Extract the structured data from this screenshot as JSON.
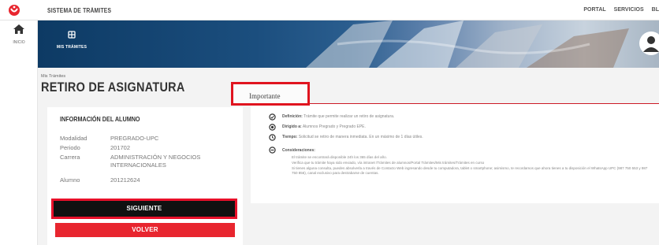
{
  "header": {
    "system_title": "SISTEMA DE TRÁMITES",
    "links": [
      "PORTAL",
      "SERVICIOS",
      "BL"
    ]
  },
  "nav": {
    "home_label": "INICIO"
  },
  "banner": {
    "module_label": "MIS TRÁMITES"
  },
  "breadcrumb": "Mis Trámites",
  "page_title": "RETIRO DE ASIGNATURA",
  "student_info": {
    "heading": "INFORMACIÓN DEL ALUMNO",
    "rows": [
      {
        "label": "Modalidad",
        "value": "PREGRADO-UPC"
      },
      {
        "label": "Periodo",
        "value": "201702"
      },
      {
        "label": "Carrera",
        "value": "ADMINISTRACIÓN Y NEGOCIOS INTERNACIONALES"
      },
      {
        "label": "Alumno",
        "value": "201212624"
      }
    ]
  },
  "buttons": {
    "next": "SIGUIENTE",
    "back": "VOLVER"
  },
  "important": {
    "tab_label": "Importante",
    "items": [
      {
        "title": "Definición:",
        "text": "Trámite que permite realizar un retiro de asignatura."
      },
      {
        "title": "Dirigido a:",
        "text": "Alumnos Pregrado y Pregrado EPE."
      },
      {
        "title": "Tiempo:",
        "text": "Solicitud se retiro de manera inmediata. En un máximo de 1 días útiles."
      },
      {
        "title": "Consideraciones:",
        "text": ""
      }
    ],
    "bullets": [
      "El trámite se encontrará disponible 24h los 365 días del año.",
      "Verifica que tu trámite haya sido enviado, vía intranet /Trámites de alumnos/Portal Trámites/Mis trámites/Trámites en curso",
      "Si tienes alguna consulta, puedes absolverla a través de Contacto Web ingresando desde tu computadora, tablet o smartphone; asimismo, te recordamos que ahora tienes a tu disposición el WhatsApp UPC (987 750 553 y 987 750 856), canal exclusivo para destrabarse de cuentas."
    ]
  },
  "colors": {
    "brand_red": "#e8262f",
    "banner_blue": "#0d3a64",
    "dark_button": "#111111"
  }
}
